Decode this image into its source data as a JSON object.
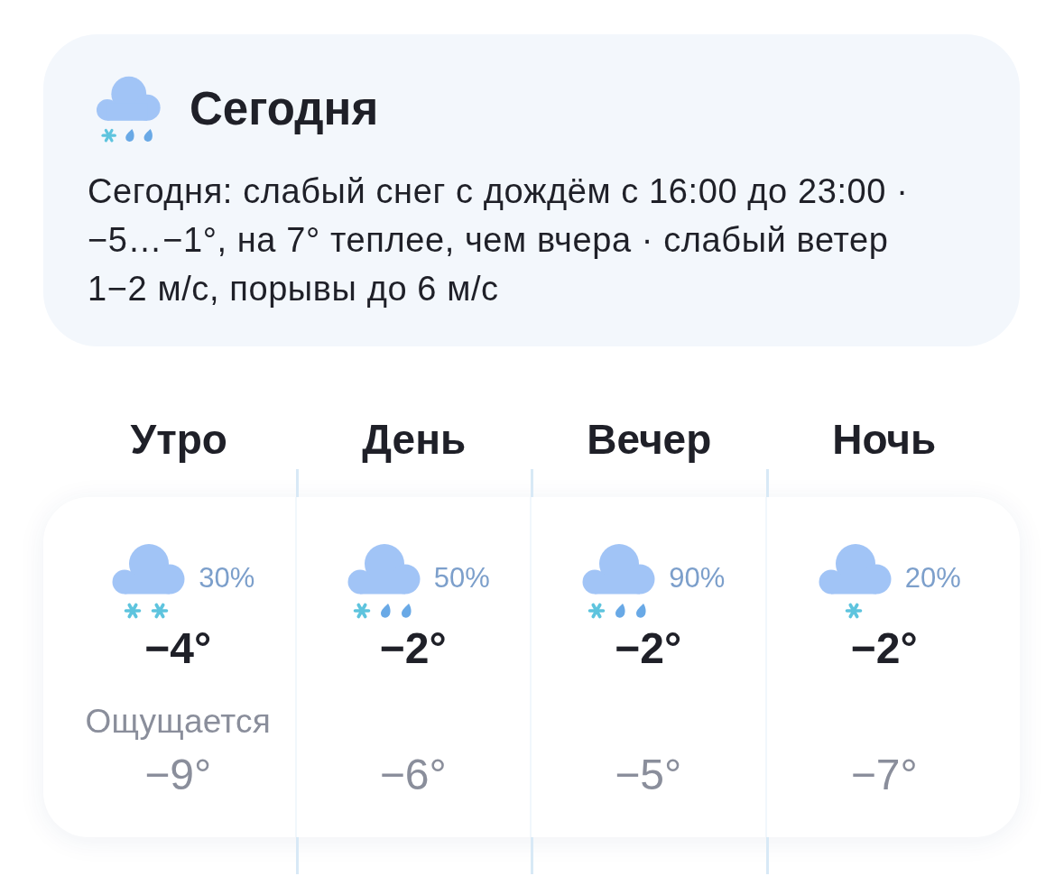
{
  "summary": {
    "kind": "sleet",
    "title": "Сегодня",
    "text": "Сегодня: слабый снег с дождём с 16:00 до 23:00 · −5…−1°, на 7° теплее, чем вчера · слабый ветер 1−2 м/с, порывы до 6 м/с"
  },
  "periods": [
    {
      "name": "Утро",
      "kind": "snow",
      "chance": "30%",
      "temp": "−4°",
      "feels_label": "Ощущается",
      "feels": "−9°"
    },
    {
      "name": "День",
      "kind": "sleet",
      "chance": "50%",
      "temp": "−2°",
      "feels": "−6°"
    },
    {
      "name": "Вечер",
      "kind": "sleet",
      "chance": "90%",
      "temp": "−2°",
      "feels": "−5°"
    },
    {
      "name": "Ночь",
      "kind": "flurries",
      "chance": "20%",
      "temp": "−2°",
      "feels": "−7°"
    }
  ]
}
